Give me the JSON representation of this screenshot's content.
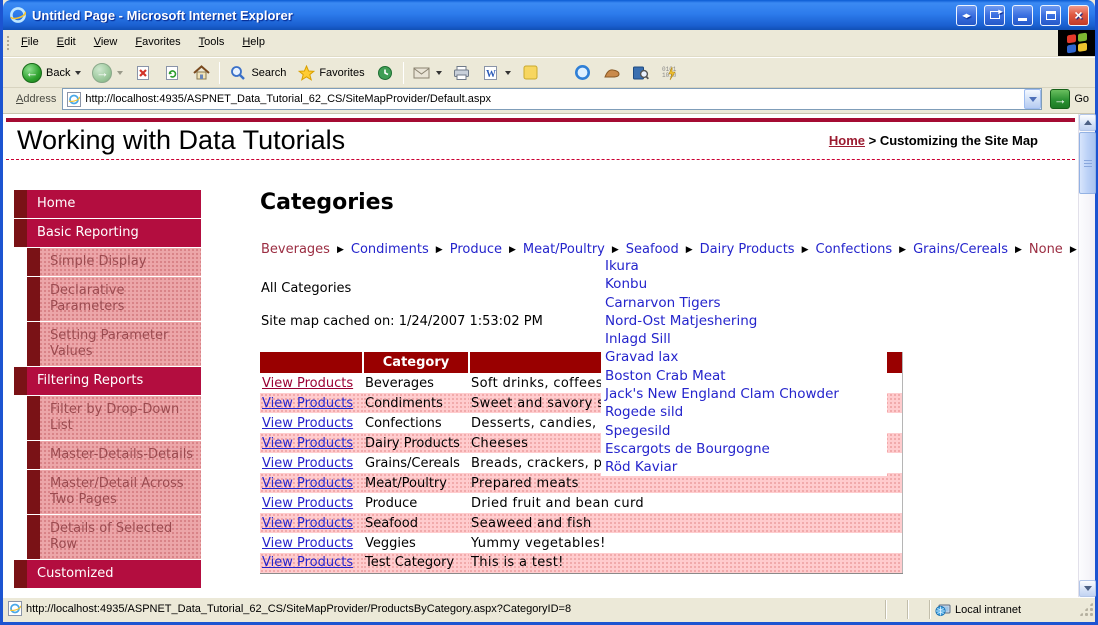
{
  "chrome": {
    "title": "Untitled Page - Microsoft Internet Explorer",
    "menus": [
      "File",
      "Edit",
      "View",
      "Favorites",
      "Tools",
      "Help"
    ],
    "toolbar": {
      "back": "Back",
      "search": "Search",
      "favorites": "Favorites"
    },
    "address": {
      "label": "Address",
      "url": "http://localhost:4935/ASPNET_Data_Tutorial_62_CS/SiteMapProvider/Default.aspx",
      "go": "Go"
    },
    "status": {
      "url": "http://localhost:4935/ASPNET_Data_Tutorial_62_CS/SiteMapProvider/ProductsByCategory.aspx?CategoryID=8",
      "zone": "Local intranet"
    }
  },
  "page": {
    "site_title": "Working with Data Tutorials",
    "breadcrumb": {
      "home": "Home",
      "sep": ">",
      "current": "Customizing the Site Map"
    },
    "sidebar": [
      {
        "label": "Home",
        "level": 1
      },
      {
        "label": "Basic Reporting",
        "level": 1
      },
      {
        "label": "Simple Display",
        "level": 2
      },
      {
        "label": "Declarative Parameters",
        "level": 2
      },
      {
        "label": "Setting Parameter Values",
        "level": 2
      },
      {
        "label": "Filtering Reports",
        "level": 1
      },
      {
        "label": "Filter by Drop-Down List",
        "level": 2
      },
      {
        "label": "Master-Details-Details",
        "level": 2
      },
      {
        "label": "Master/Detail Across Two Pages",
        "level": 2
      },
      {
        "label": "Details of Selected Row",
        "level": 2
      },
      {
        "label": "Customized",
        "level": 1
      }
    ],
    "heading": "Categories",
    "category_menu": [
      "Beverages",
      "Condiments",
      "Produce",
      "Meat/Poultry",
      "Seafood",
      "Dairy Products",
      "Confections",
      "Grains/Cereals",
      "None"
    ],
    "intro": "All Categories",
    "cache_note": "Site map cached on: 1/24/2007 1:53:02 PM",
    "table": {
      "headers": {
        "col1": "",
        "col2": "Category",
        "col3": ""
      },
      "link_label": "View Products",
      "rows": [
        {
          "category": "Beverages",
          "description": "Soft drinks, coffees, teas, beers, and ales"
        },
        {
          "category": "Condiments",
          "description": "Sweet and savory sauces, relishes, spreads, and seasonings"
        },
        {
          "category": "Confections",
          "description": "Desserts, candies, and sweet breads"
        },
        {
          "category": "Dairy Products",
          "description": "Cheeses"
        },
        {
          "category": "Grains/Cereals",
          "description": "Breads, crackers, pasta, and cereal"
        },
        {
          "category": "Meat/Poultry",
          "description": "Prepared meats"
        },
        {
          "category": "Produce",
          "description": "Dried fruit and bean curd"
        },
        {
          "category": "Seafood",
          "description": "Seaweed and fish"
        },
        {
          "category": "Veggies",
          "description": "Yummy vegetables!"
        },
        {
          "category": "Test Category",
          "description": "This is a test!"
        }
      ]
    },
    "submenu": [
      "Ikura",
      "Konbu",
      "Carnarvon Tigers",
      "Nord-Ost Matjeshering",
      "Inlagd Sill",
      "Gravad lax",
      "Boston Crab Meat",
      "Jack's New England Clam Chowder",
      "Rogede sild",
      "Spegesild",
      "Escargots de Bourgogne",
      "Röd Kaviar"
    ]
  },
  "colors": {
    "crimson": "#b30d3f",
    "dark_maroon": "#7a1216",
    "table_header": "#990000",
    "pink_row": "#ffccce",
    "pink_sidebar": "#eca6a9",
    "link_blue": "#2424cc",
    "link_maroon": "#990033",
    "titlebar_blue": "#2d7cec"
  }
}
